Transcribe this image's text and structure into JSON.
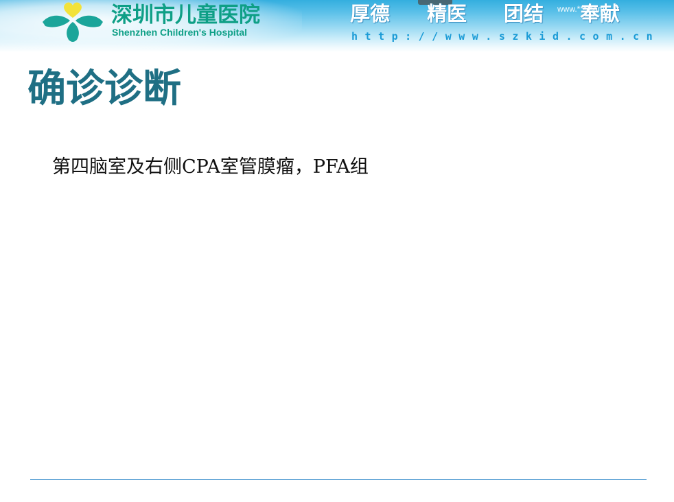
{
  "header": {
    "hospital_name_cn": "深圳市儿童医院",
    "hospital_name_en": "Shenzhen Children's Hospital",
    "motto": [
      "厚德",
      "精医",
      "团结",
      "奉献"
    ],
    "url": "http://www.szkid.com.cn",
    "watermark": "www.***.com",
    "logo_icon": "hospital-logo-icon"
  },
  "slide": {
    "title": "确诊诊断",
    "body": "第四脑室及右侧CPA室管膜瘤，PFA组"
  },
  "colors": {
    "banner_blue": "#34aedf",
    "logo_green": "#0e9f86",
    "logo_teal": "#1ba59a",
    "logo_yellow": "#f2e23a",
    "title_teal": "#1f6f84",
    "url_blue": "#1a9bd6",
    "footer_rule": "#2a86c8"
  }
}
